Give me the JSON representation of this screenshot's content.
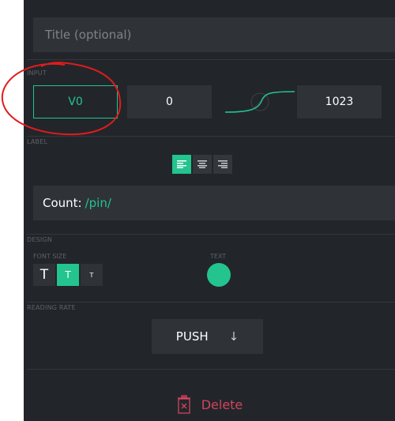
{
  "title_field": {
    "placeholder": "Title (optional)"
  },
  "input_section": {
    "label": "INPUT",
    "pin": "V0",
    "min": "0",
    "max": "1023"
  },
  "label_section": {
    "label": "LABEL",
    "text_prefix": "Count:",
    "text_pin": "/pin/"
  },
  "design_section": {
    "label": "DESIGN",
    "font_size_label": "FONT SIZE",
    "font_sizes": [
      "T",
      "T",
      "T"
    ],
    "text_label": "TEXT",
    "text_color": "#23c48e"
  },
  "reading_rate": {
    "label": "READING RATE",
    "value": "PUSH",
    "arrow": "↓"
  },
  "delete": {
    "label": "Delete"
  },
  "colors": {
    "accent": "#23c48e",
    "danger": "#d3435c",
    "panel": "#22262b",
    "field": "#2f3338"
  }
}
